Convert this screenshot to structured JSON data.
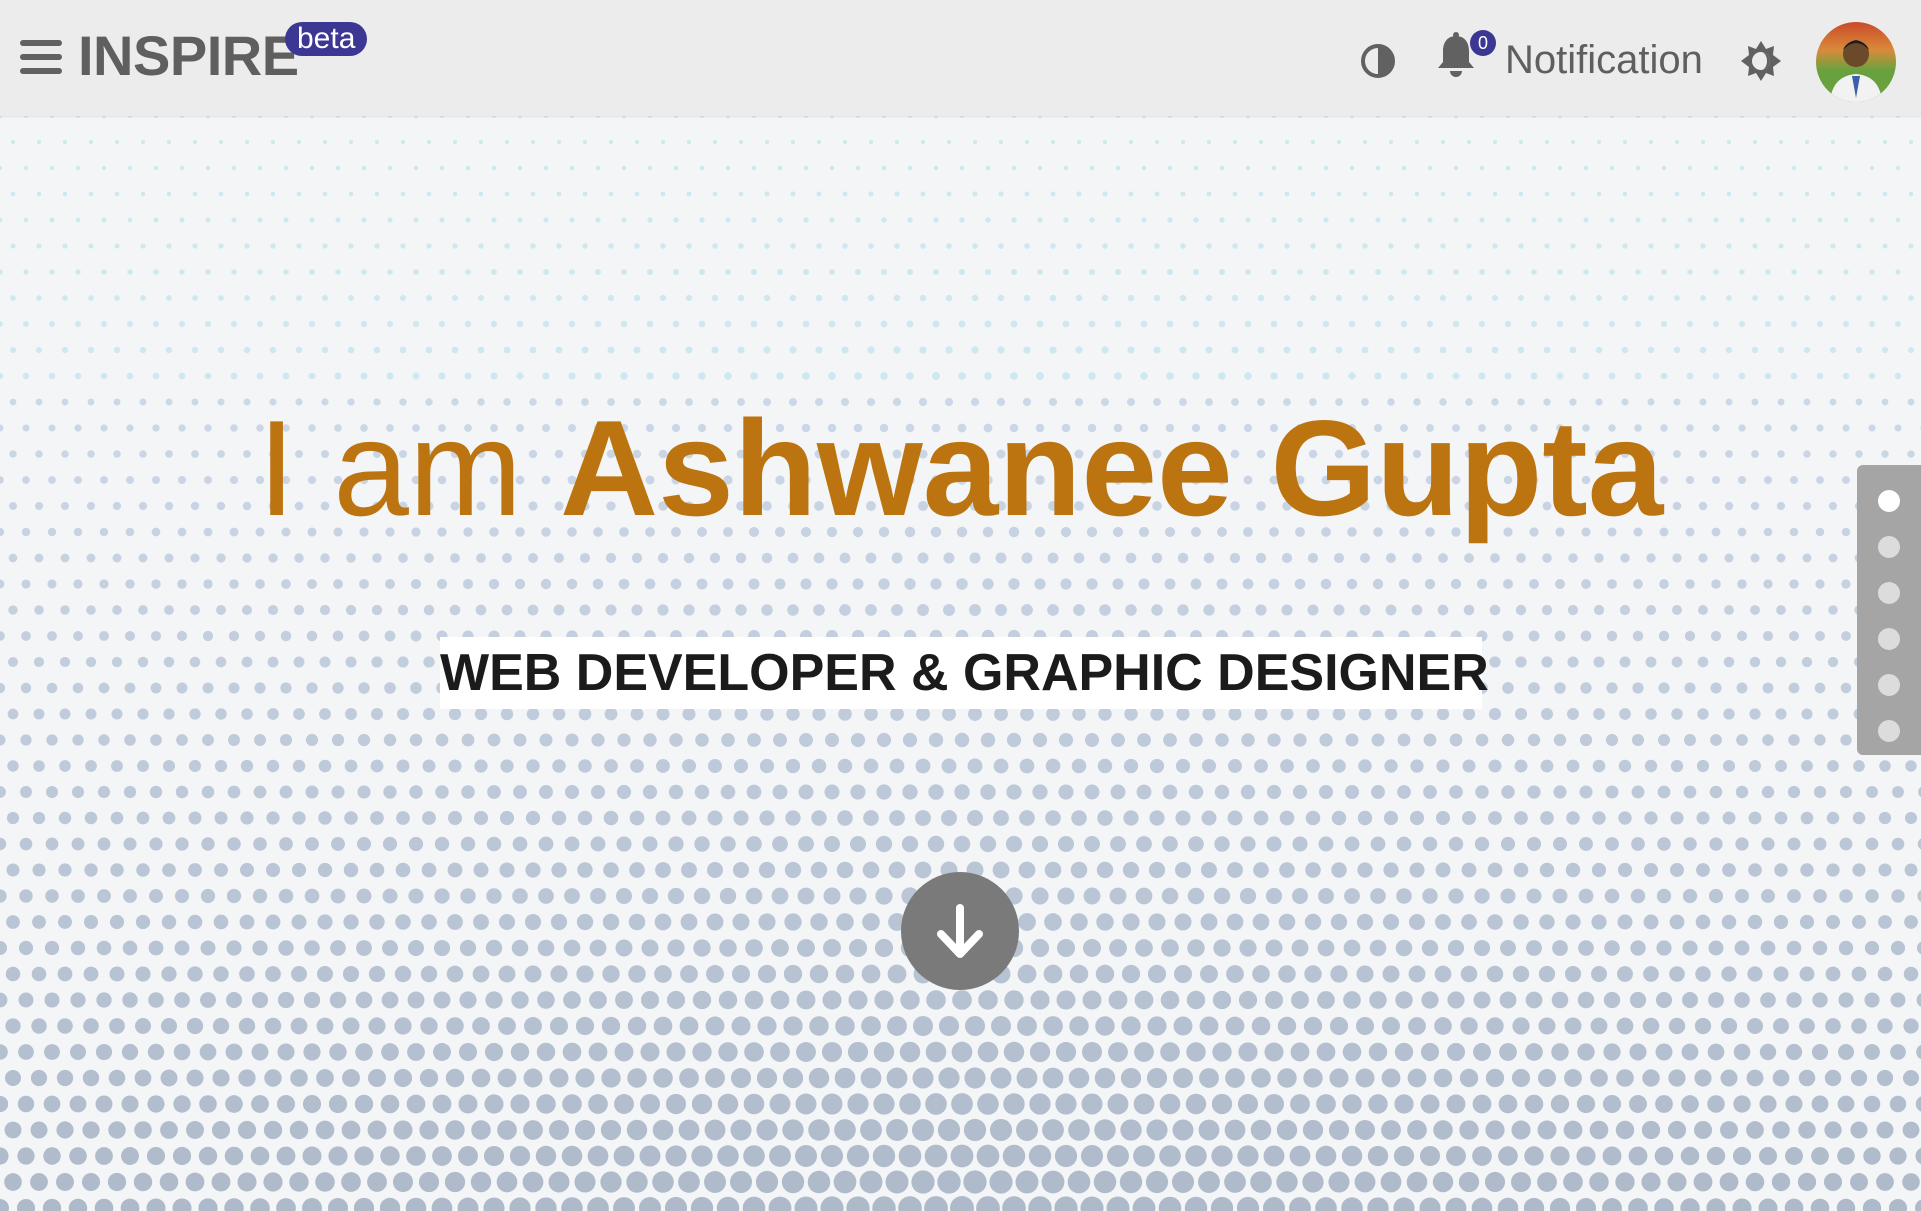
{
  "header": {
    "brand": "INSPIRE",
    "badge": "beta",
    "notification_count": "0",
    "notification_label": "Notification",
    "icons": [
      "menu-icon",
      "contrast-icon",
      "bell-icon",
      "theme-toggle-icon",
      "avatar"
    ]
  },
  "hero": {
    "intro": "I am ",
    "name": "Ashwanee Gupta",
    "tagline": "WEB DEVELOPER & GRAPHIC DESIGNER",
    "scroll_icon": "arrow-down-icon"
  },
  "section_nav": {
    "count": 6,
    "active_index": 0
  },
  "colors": {
    "accent": "#bb7410",
    "badge": "#3b3793",
    "header_bg": "#ececec",
    "dot_pattern": "#b9c9d9"
  }
}
